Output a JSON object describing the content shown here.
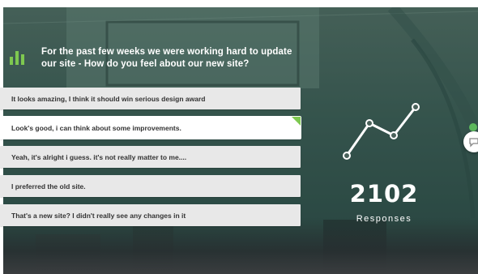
{
  "question": {
    "icon": "bar-chart-icon",
    "line1": "For the past few weeks we were working hard to update",
    "line2": "our site - How do you feel about our new site?"
  },
  "options": [
    {
      "label": "It looks amazing, I think it should win serious design award",
      "selected": false
    },
    {
      "label": "Look's good, i can think about some improvements.",
      "selected": true
    },
    {
      "label": "Yeah, it's alright i guess. it's not really matter to me....",
      "selected": false
    },
    {
      "label": "I preferred the old site.",
      "selected": false
    },
    {
      "label": "That's a new site? I didn't  really see any changes in it",
      "selected": false
    }
  ],
  "stats": {
    "icon": "trend-line-icon",
    "count": "2102",
    "label": "Responses"
  },
  "chat": {
    "icon": "chat-bubble-icon"
  },
  "colors": {
    "accent_green": "#7ec850",
    "option_bg": "#e8e8e8",
    "selected_bg": "#ffffff",
    "overlay": "#3f5a53"
  }
}
